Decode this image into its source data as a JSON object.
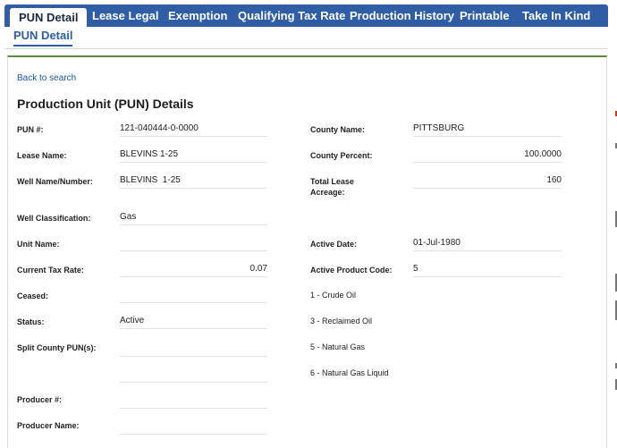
{
  "tabs": [
    {
      "label": "PUN Detail"
    },
    {
      "label": "Lease Legal"
    },
    {
      "label": "Exemption"
    },
    {
      "label": "Qualifying Tax Rate"
    },
    {
      "label": "Production History"
    },
    {
      "label": "Printable"
    },
    {
      "label": "Take In Kind"
    }
  ],
  "subtab": {
    "label": "PUN Detail"
  },
  "back_link": "Back to search",
  "page_title": "Production Unit (PUN) Details",
  "left": {
    "pun_label": "PUN #:",
    "pun_value": "121-040444-0-0000",
    "lease_name_label": "Lease Name:",
    "lease_name_value": "BLEVINS 1-25",
    "well_name_label": "Well Name/Number:",
    "well_name_value": "BLEVINS  1-25",
    "well_class_label": "Well Classification:",
    "well_class_value": "Gas",
    "unit_name_label": "Unit Name:",
    "unit_name_value": "",
    "tax_rate_label": "Current Tax Rate:",
    "tax_rate_value": "0.07",
    "ceased_label": "Ceased:",
    "ceased_value": "",
    "status_label": "Status:",
    "status_value": "Active",
    "split_county_label": "Split County PUN(s):",
    "split_county_value": "",
    "producer_num_label": "Producer #:",
    "producer_num_value": "",
    "producer_name_label": "Producer Name:",
    "producer_name_value": ""
  },
  "right": {
    "county_name_label": "County Name:",
    "county_name_value": "PITTSBURG",
    "county_pct_label": "County Percent:",
    "county_pct_value": "100.0000",
    "acreage_label_line1": "Total Lease",
    "acreage_label_line2": "Acreage:",
    "acreage_value": "160",
    "active_date_label": "Active Date:",
    "active_date_value": "01-Jul-1980",
    "active_product_label": "Active Product Code:",
    "active_product_value": "5",
    "product_codes": [
      "1 - Crude Oil",
      "3 - Reclaimed Oil",
      "5 - Natural Gas",
      "6 - Natural Gas Liquid"
    ]
  },
  "colors": {
    "tabbar": "#2f5ea6",
    "accent_line": "#5d8a3c",
    "link": "#1a55a6"
  }
}
